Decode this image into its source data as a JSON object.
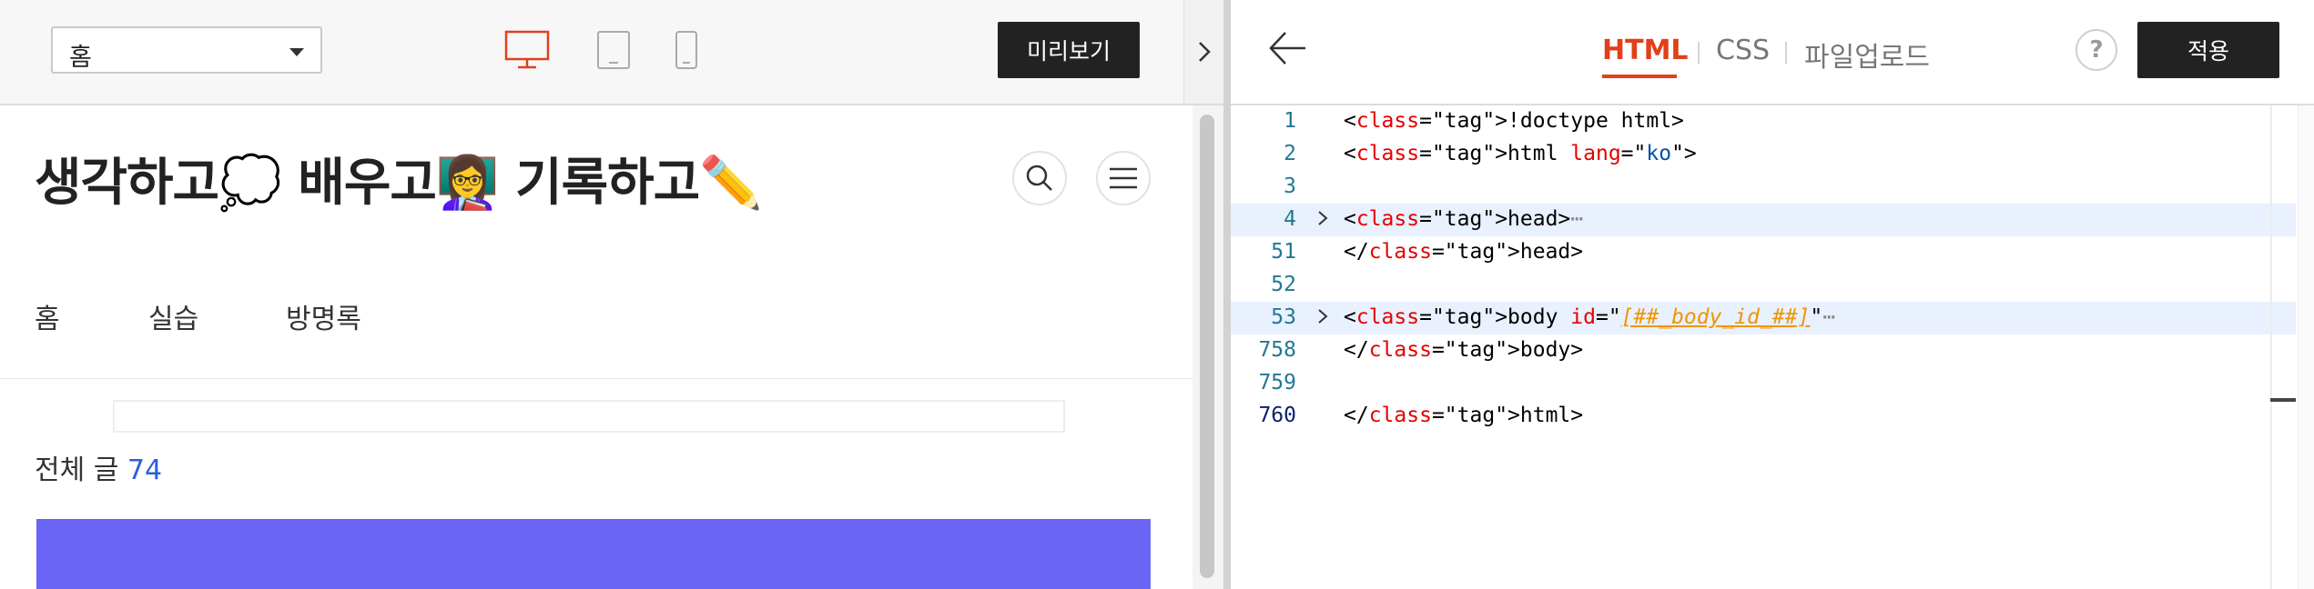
{
  "left_toolbar": {
    "page_select": {
      "value": "홈"
    },
    "devices": {
      "desktop": "desktop-icon",
      "tablet": "tablet-icon",
      "mobile": "mobile-icon"
    },
    "preview_label": "미리보기",
    "collapse_icon": "chevron-right-icon"
  },
  "blog": {
    "title": "생각하고💭 배우고👩‍🏫 기록하고✏️",
    "nav": [
      "홈",
      "실습",
      "방명록"
    ],
    "total_label": "전체 글",
    "total_count": "74",
    "banner_color": "#6b65f5"
  },
  "right_toolbar": {
    "tabs": [
      "HTML",
      "CSS",
      "파일업로드"
    ],
    "active_tab": "HTML",
    "help_label": "?",
    "apply_label": "적용"
  },
  "editor": {
    "lines": [
      {
        "num": "1",
        "text": "<!doctype html>"
      },
      {
        "num": "2",
        "text": "<html lang=\"ko\">"
      },
      {
        "num": "3",
        "text": ""
      },
      {
        "num": "4",
        "text": "<head>⋯"
      },
      {
        "num": "51",
        "text": "</head>"
      },
      {
        "num": "52",
        "text": ""
      },
      {
        "num": "53",
        "text": "<body id=\"[##_body_id_##]\"⋯"
      },
      {
        "num": "758",
        "text": "</body>"
      },
      {
        "num": "759",
        "text": ""
      },
      {
        "num": "760",
        "text": "</html>"
      }
    ]
  },
  "colors": {
    "accent": "#e0401a",
    "dark_button": "#222222",
    "link_blue": "#2b5fe0"
  }
}
